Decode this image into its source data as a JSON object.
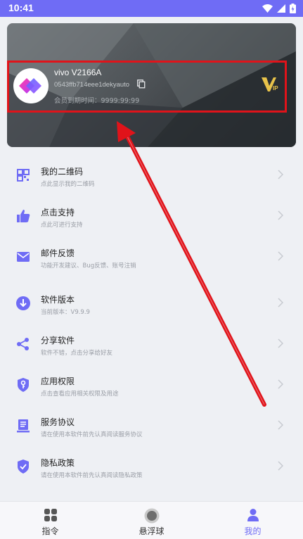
{
  "status_bar": {
    "time": "10:41"
  },
  "profile": {
    "device_name": "vivo V2166A",
    "device_id": "0543ffb714eee1dekyauto",
    "member_expiry": "会员到期时间：9999:99:99",
    "vip_label": "VIP"
  },
  "menu": {
    "items": [
      {
        "title": "我的二维码",
        "subtitle": "点此显示我的二维码",
        "icon": "qr-code-icon"
      },
      {
        "title": "点击支持",
        "subtitle": "点此可进行支持",
        "icon": "thumbs-up-icon"
      },
      {
        "title": "邮件反馈",
        "subtitle": "功能开发建议、Bug反馈、账号注销",
        "icon": "mail-icon"
      },
      {
        "title": "软件版本",
        "subtitle": "当前版本：V9.9.9",
        "icon": "download-icon"
      },
      {
        "title": "分享软件",
        "subtitle": "软件不错，点击分享给好友",
        "icon": "share-icon"
      },
      {
        "title": "应用权限",
        "subtitle": "点击查看应用相关权限及用途",
        "icon": "key-shield-icon"
      },
      {
        "title": "服务协议",
        "subtitle": "请在使用本软件前先认真阅读服务协议",
        "icon": "document-icon"
      },
      {
        "title": "隐私政策",
        "subtitle": "请在使用本软件前先认真阅读隐私政策",
        "icon": "check-shield-icon"
      }
    ]
  },
  "bottom_nav": {
    "items": [
      {
        "label": "指令",
        "icon": "grid-icon"
      },
      {
        "label": "悬浮球",
        "icon": "floating-ball-icon"
      },
      {
        "label": "我的",
        "icon": "person-icon"
      }
    ],
    "active_index": 2
  },
  "colors": {
    "accent": "#6f6cf5",
    "highlight_box": "#e0131a",
    "vip_gold": "#e8c34a"
  }
}
